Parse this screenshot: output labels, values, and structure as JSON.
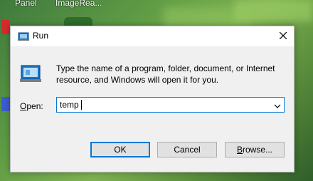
{
  "desktop": {
    "labels": [
      "Panel",
      "ImageRea..."
    ]
  },
  "dialog": {
    "title": "Run",
    "icons": {
      "title": "run-icon",
      "close": "close-icon",
      "main": "run-program-icon",
      "dropdown": "chevron-down-icon"
    },
    "description": "Type the name of a program, folder, document, or Internet resource, and Windows will open it for you.",
    "open_label_underlined": "O",
    "open_label_rest": "pen:",
    "open_value": "temp",
    "buttons": {
      "ok": "OK",
      "cancel": "Cancel",
      "browse_underlined": "B",
      "browse_rest": "rowse..."
    },
    "colors": {
      "accent": "#0078d7",
      "background": "#f0f0f0",
      "titlebar": "#ffffff"
    }
  }
}
